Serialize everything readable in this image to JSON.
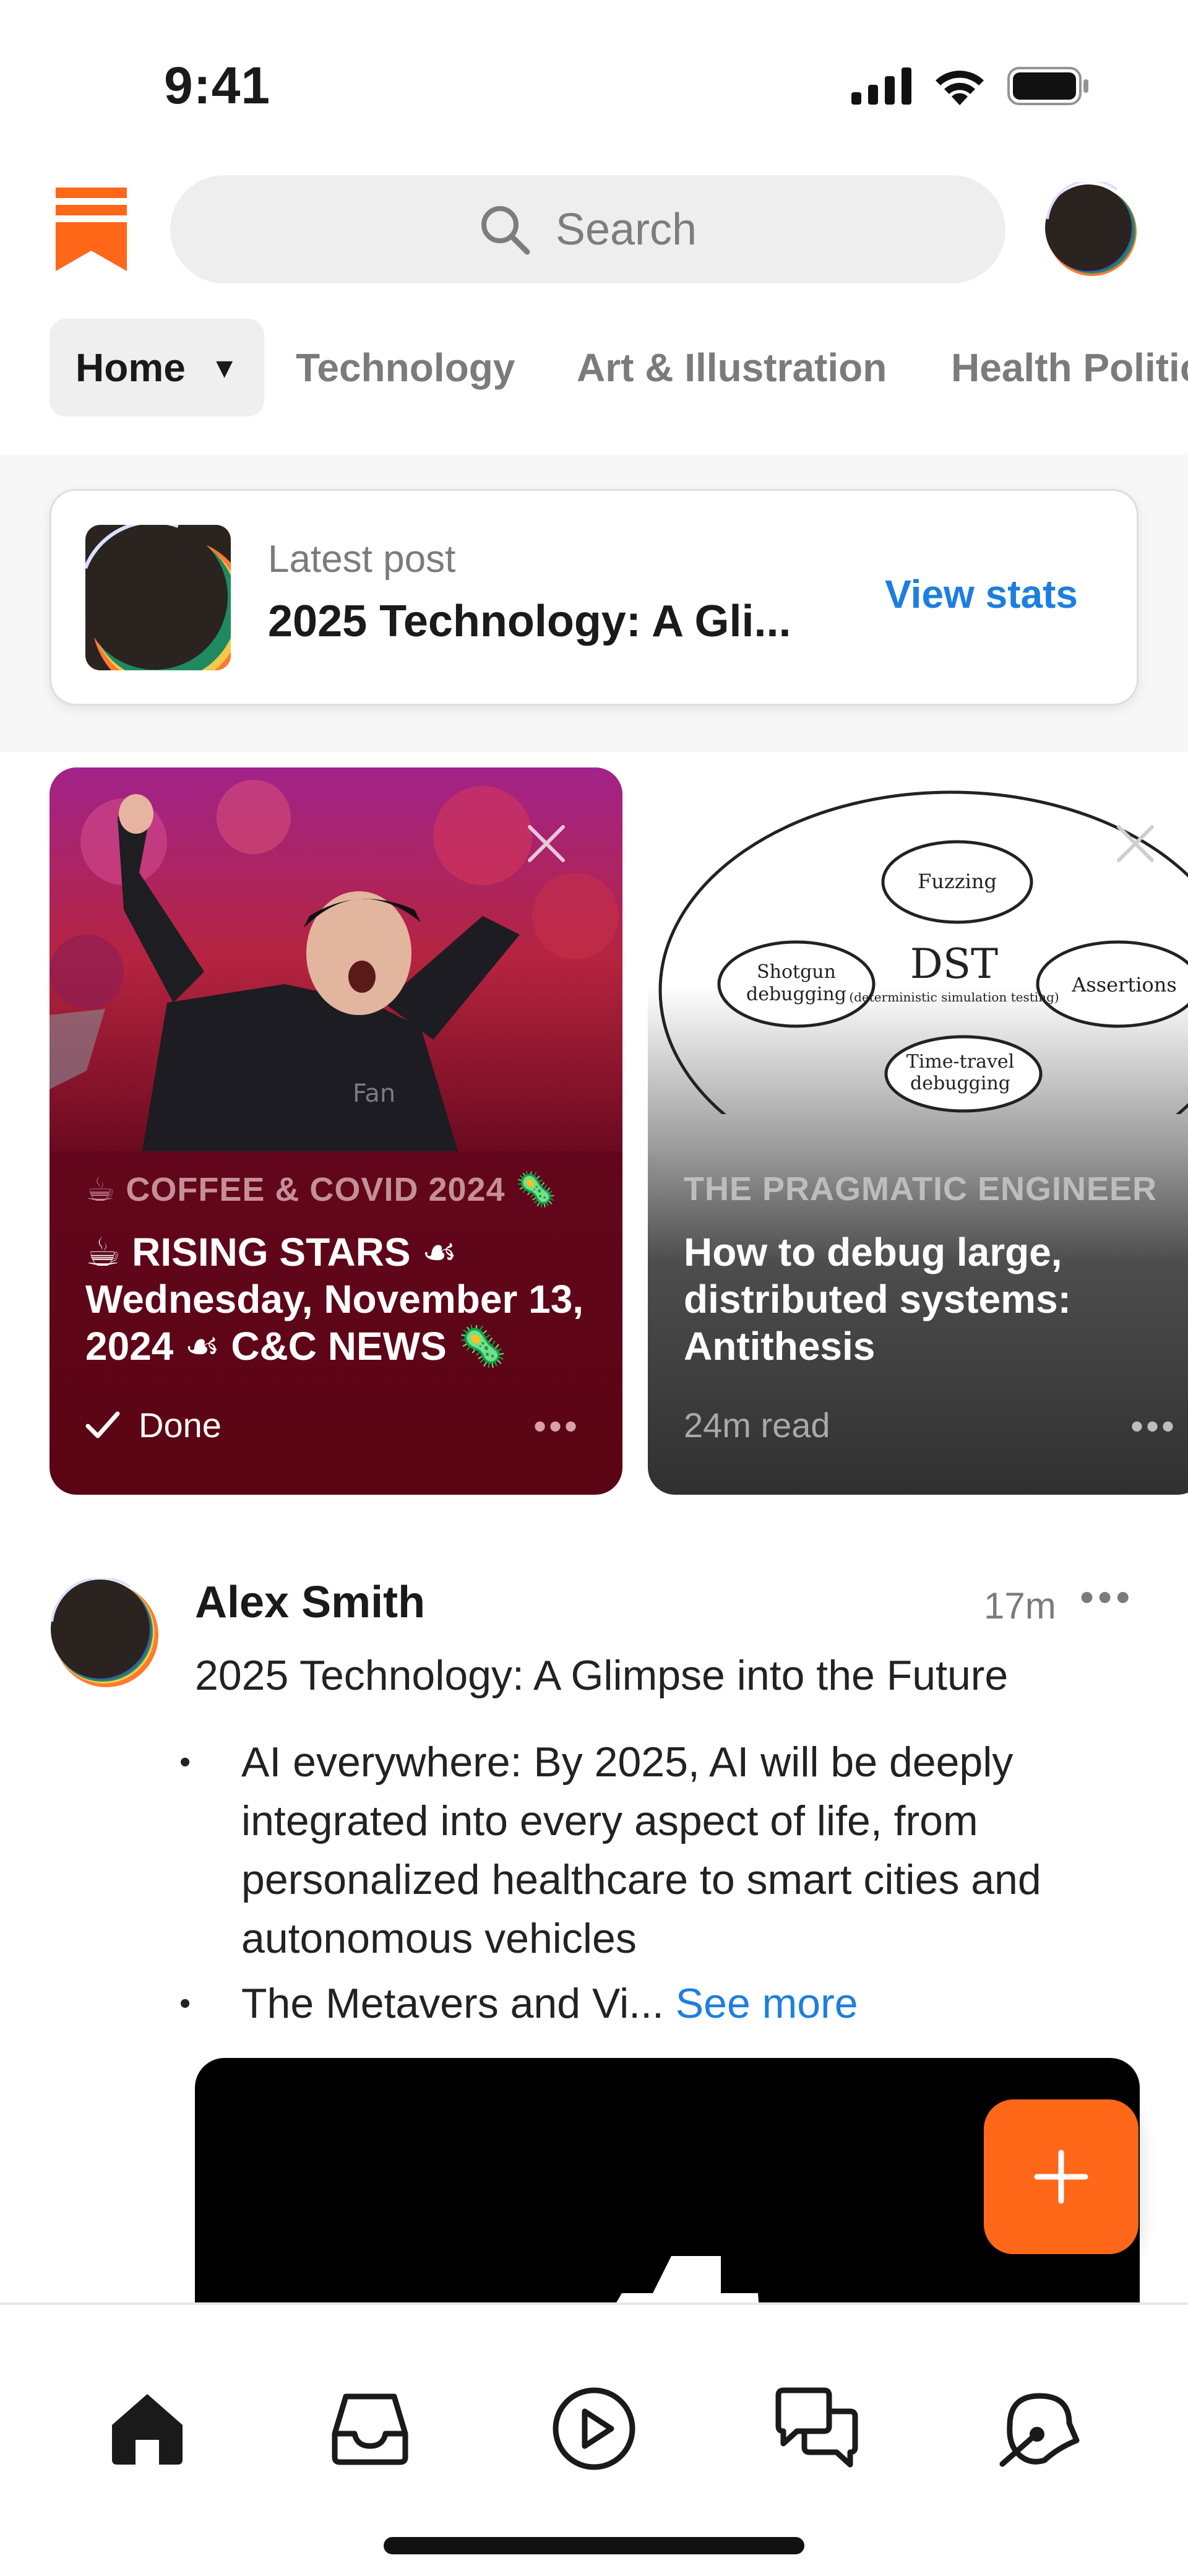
{
  "status_bar": {
    "time": "9:41"
  },
  "header": {
    "search_placeholder": "Search"
  },
  "tabs": [
    {
      "label": "Home",
      "active": true
    },
    {
      "label": "Technology"
    },
    {
      "label": "Art & Illustration"
    },
    {
      "label": "Health Politic"
    }
  ],
  "latest_post": {
    "label": "Latest post",
    "title": "2025 Technology: A Gli...",
    "action": "View stats"
  },
  "cards": [
    {
      "publication": "☕ COFFEE & COVID 2024 🦠",
      "headline": "☕ RISING STARS ☙ Wednesday, November 13, 2024 ☙ C&C NEWS 🦠",
      "footer": "Done",
      "status": "done"
    },
    {
      "publication": "THE PRAGMATIC ENGINEER",
      "headline": "How to debug large, distributed systems: Antithesis",
      "footer": "24m read",
      "diagram": {
        "center": "DST",
        "center_sub": "(deterministic simulation testing)",
        "nodes": [
          "Fuzzing",
          "Shotgun debugging",
          "Assertions",
          "Time-travel debugging"
        ]
      }
    }
  ],
  "post": {
    "author": "Alex Smith",
    "time": "17m",
    "title": "2025 Technology: A Glimpse into the Future",
    "bullets": [
      "AI everywhere: By 2025, AI will be deeply integrated into every aspect of life, from personalized healthcare to smart cities and autonomous vehicles",
      "The Metavers and Vi..."
    ],
    "see_more": "See more"
  },
  "bottom_nav": [
    {
      "name": "home",
      "active": true
    },
    {
      "name": "inbox"
    },
    {
      "name": "video"
    },
    {
      "name": "chat"
    },
    {
      "name": "activity"
    }
  ],
  "colors": {
    "brand": "#ff6719",
    "link": "#1c7fe0",
    "card1_bg": "#64061e"
  }
}
